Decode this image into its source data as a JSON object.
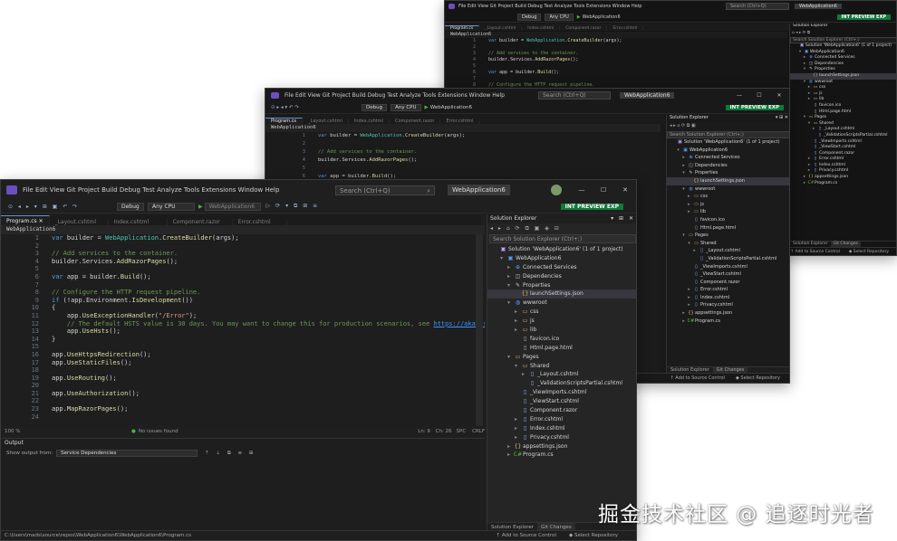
{
  "app": {
    "title": "WebApplication6",
    "search_placeholder": "Search (Ctrl+Q)",
    "menu": [
      "File",
      "Edit",
      "View",
      "Git",
      "Project",
      "Build",
      "Debug",
      "Test",
      "Analyze",
      "Tools",
      "Extensions",
      "Window",
      "Help"
    ],
    "preview_label": "INT PREVIEW  EXP"
  },
  "toolbar": {
    "config": "Debug",
    "platform": "Any CPU",
    "run_target": "WebApplication6"
  },
  "editor": {
    "tabs": [
      "Program.cs",
      "_Layout.cshtml",
      "Index.cshtml",
      "Component.razor",
      "Error.cshtml"
    ],
    "nav_label": "WebApplication6",
    "lines": [
      {
        "n": "1",
        "c": "var builder = WebApplication.CreateBuilder(args);"
      },
      {
        "n": "2",
        "c": ""
      },
      {
        "n": "3",
        "c": "// Add services to the container."
      },
      {
        "n": "4",
        "c": "builder.Services.AddRazorPages();"
      },
      {
        "n": "5",
        "c": ""
      },
      {
        "n": "6",
        "c": "var app = builder.Build();"
      },
      {
        "n": "7",
        "c": ""
      },
      {
        "n": "8",
        "c": "// Configure the HTTP request pipeline."
      },
      {
        "n": "9",
        "c": "if (!app.Environment.IsDevelopment())"
      },
      {
        "n": "10",
        "c": "{"
      },
      {
        "n": "11",
        "c": "    app.UseExceptionHandler(\"/Error\");"
      },
      {
        "n": "12",
        "c": "    // The default HSTS value is 30 days. You may want to change this for production scenarios, see https://aka.ms/aspne"
      },
      {
        "n": "13",
        "c": "    app.UseHsts();"
      },
      {
        "n": "14",
        "c": "}"
      },
      {
        "n": "15",
        "c": ""
      },
      {
        "n": "16",
        "c": "app.UseHttpsRedirection();"
      },
      {
        "n": "17",
        "c": "app.UseStaticFiles();"
      },
      {
        "n": "18",
        "c": ""
      },
      {
        "n": "19",
        "c": "app.UseRouting();"
      },
      {
        "n": "20",
        "c": ""
      },
      {
        "n": "21",
        "c": "app.UseAuthorization();"
      },
      {
        "n": "22",
        "c": ""
      },
      {
        "n": "23",
        "c": "app.MapRazorPages();"
      },
      {
        "n": "24",
        "c": ""
      }
    ],
    "zoom": "100 %",
    "issues": "No issues found",
    "ln_col": "Ln: 9",
    "ch": "Ch: 26",
    "spc": "SPC",
    "crlf": "CRLF"
  },
  "output": {
    "title": "Output",
    "show_from_label": "Show output from:",
    "source": "Service Dependencies"
  },
  "solution": {
    "title": "Solution Explorer",
    "search": "Search Solution Explorer (Ctrl+;)",
    "items": [
      {
        "label": "Solution 'WebApplication6' (1 of 1 project)",
        "level": 0,
        "chev": "",
        "icon": "solution-icon"
      },
      {
        "label": "WebApplication6",
        "level": 1,
        "chev": "▾",
        "icon": "project-icon"
      },
      {
        "label": "Connected Services",
        "level": 2,
        "chev": "▸",
        "icon": "connected-icon"
      },
      {
        "label": "Dependencies",
        "level": 2,
        "chev": "▸",
        "icon": "dependencies-icon"
      },
      {
        "label": "Properties",
        "level": 2,
        "chev": "▾",
        "icon": "properties-icon"
      },
      {
        "label": "launchSettings.json",
        "level": 3,
        "chev": "",
        "icon": "json-icon",
        "sel": true
      },
      {
        "label": "wwwroot",
        "level": 2,
        "chev": "▾",
        "icon": "globe-icon"
      },
      {
        "label": "css",
        "level": 3,
        "chev": "▸",
        "icon": "folder-icon"
      },
      {
        "label": "js",
        "level": 3,
        "chev": "▸",
        "icon": "folder-icon"
      },
      {
        "label": "lib",
        "level": 3,
        "chev": "▸",
        "icon": "folder-icon"
      },
      {
        "label": "favicon.ico",
        "level": 3,
        "chev": "",
        "icon": "file-icon"
      },
      {
        "label": "Html.page.html",
        "level": 3,
        "chev": "",
        "icon": "file-icon"
      },
      {
        "label": "Pages",
        "level": 2,
        "chev": "▾",
        "icon": "folder-icon"
      },
      {
        "label": "Shared",
        "level": 3,
        "chev": "▾",
        "icon": "folder-icon"
      },
      {
        "label": "_Layout.cshtml",
        "level": 4,
        "chev": "▸",
        "icon": "razor-icon"
      },
      {
        "label": "_ValidationScriptsPartial.cshtml",
        "level": 4,
        "chev": "",
        "icon": "razor-icon"
      },
      {
        "label": "_ViewImports.cshtml",
        "level": 3,
        "chev": "",
        "icon": "razor-icon"
      },
      {
        "label": "_ViewStart.cshtml",
        "level": 3,
        "chev": "",
        "icon": "razor-icon"
      },
      {
        "label": "Component.razor",
        "level": 3,
        "chev": "",
        "icon": "razor-icon"
      },
      {
        "label": "Error.cshtml",
        "level": 3,
        "chev": "▸",
        "icon": "razor-icon"
      },
      {
        "label": "Index.cshtml",
        "level": 3,
        "chev": "▸",
        "icon": "razor-icon"
      },
      {
        "label": "Privacy.cshtml",
        "level": 3,
        "chev": "▸",
        "icon": "razor-icon"
      },
      {
        "label": "appsettings.json",
        "level": 2,
        "chev": "▸",
        "icon": "json-icon"
      },
      {
        "label": "Program.cs",
        "level": 2,
        "chev": "▸",
        "icon": "cs-icon"
      }
    ],
    "footer_tabs": [
      "Solution Explorer",
      "Git Changes"
    ]
  },
  "status": {
    "path": "C:\\Users\\mads\\source\\repos\\WebApplication6\\WebApplication6\\Program.cs",
    "add_source": "Add to Source Control",
    "repo": "Select Repository"
  },
  "watermark": "掘金技术社区 @ 追逐时光者"
}
